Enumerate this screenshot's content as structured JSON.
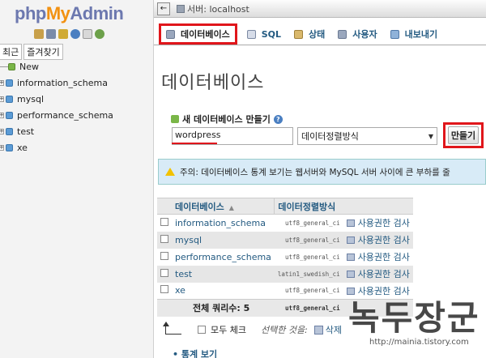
{
  "sidebar": {
    "logo": {
      "php": "php",
      "my": "My",
      "admin": "Admin"
    },
    "tabs": [
      "최근",
      "즐겨찾기"
    ],
    "tree": [
      {
        "label": "New",
        "kind": "new"
      },
      {
        "label": "information_schema",
        "kind": "db"
      },
      {
        "label": "mysql",
        "kind": "db"
      },
      {
        "label": "performance_schema",
        "kind": "db"
      },
      {
        "label": "test",
        "kind": "db"
      },
      {
        "label": "xe",
        "kind": "db"
      }
    ]
  },
  "topbar": {
    "breadcrumb": "서버: localhost"
  },
  "tabs": [
    {
      "label": "데이터베이스",
      "icon": "database-icon",
      "active": true
    },
    {
      "label": "SQL",
      "icon": "sql-icon"
    },
    {
      "label": "상태",
      "icon": "status-icon"
    },
    {
      "label": "사용자",
      "icon": "users-icon"
    },
    {
      "label": "내보내기",
      "icon": "export-icon"
    }
  ],
  "main": {
    "title": "데이터베이스",
    "create_label": "새 데이터베이스 만들기",
    "db_name_value": "wordpress",
    "collation_placeholder": "데이터정렬방식",
    "create_button": "만들기",
    "notice": "주의: 데이터베이스 통계 보기는 웹서버와 MySQL 서버 사이에 큰 부하를 줄"
  },
  "table": {
    "headers": {
      "name": "데이터베이스",
      "collation": "데이터정렬방식"
    },
    "rows": [
      {
        "name": "information_schema",
        "collation": "utf8_general_ci",
        "action": "사용권한 검사"
      },
      {
        "name": "mysql",
        "collation": "utf8_general_ci",
        "action": "사용권한 검사"
      },
      {
        "name": "performance_schema",
        "collation": "utf8_general_ci",
        "action": "사용권한 검사"
      },
      {
        "name": "test",
        "collation": "latin1_swedish_ci",
        "action": "사용권한 검사"
      },
      {
        "name": "xe",
        "collation": "utf8_general_ci",
        "action": "사용권한 검사"
      }
    ],
    "footer": {
      "total": "전체 쿼리수: 5",
      "collation": "utf8_general_ci"
    }
  },
  "bulk": {
    "check_all": "모두 체크",
    "with_selected": "선택한 것을:",
    "delete": "삭제"
  },
  "stats_link": "• 통계 보기",
  "watermark": {
    "big": "녹두장군",
    "url": "http://mainia.tistory.com"
  }
}
